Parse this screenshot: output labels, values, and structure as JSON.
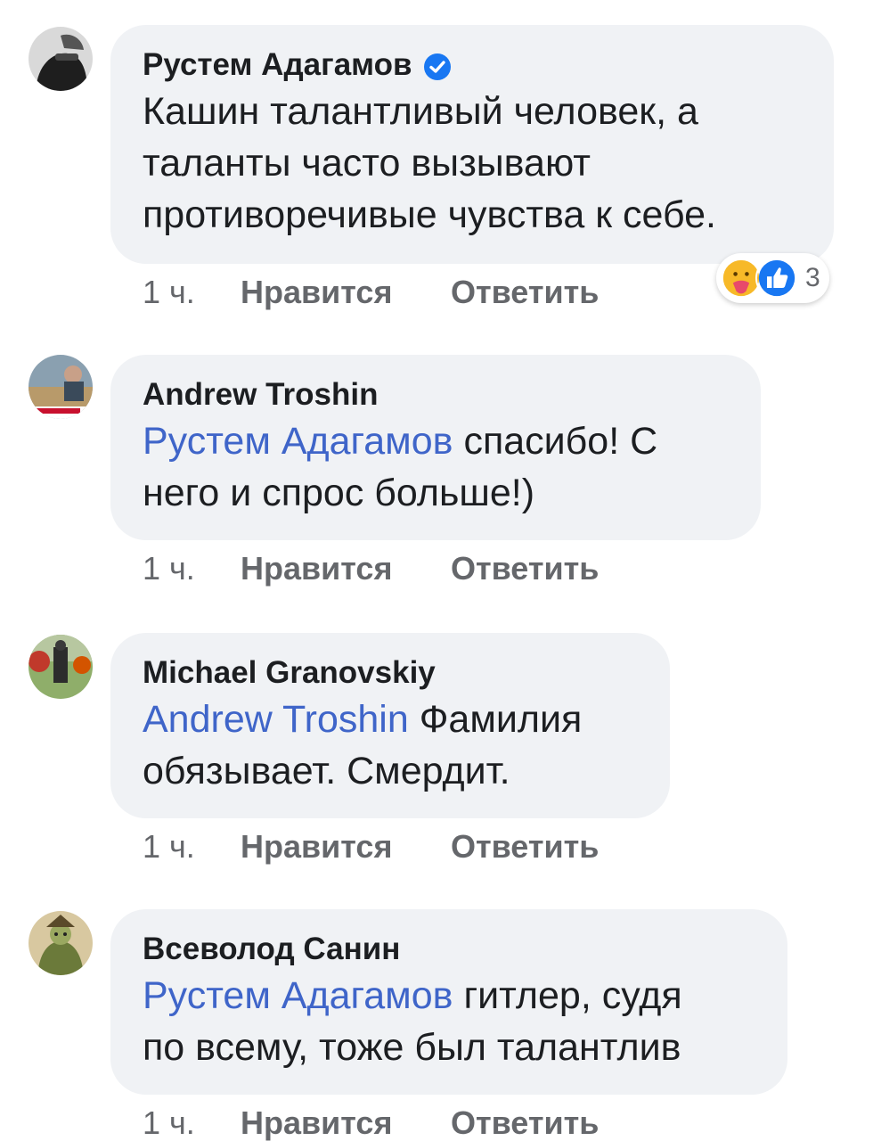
{
  "comments": [
    {
      "author": "Рустем Адагамов",
      "verified": true,
      "mention": "",
      "lines": [
        "Кашин талантливый человек, а",
        "таланты часто вызывают",
        "противоречивые чувства к себе."
      ],
      "time": "1 ч.",
      "like_label": "Нравится",
      "reply_label": "Ответить",
      "reactions": {
        "icons": [
          "care-icon",
          "like-icon"
        ],
        "count": "3"
      }
    },
    {
      "author": "Andrew Troshin",
      "verified": false,
      "mention": "Рустем Адагамов",
      "line1_rest": " спасибо! С",
      "lines": [
        "него и спрос больше!)"
      ],
      "time": "1 ч.",
      "like_label": "Нравится",
      "reply_label": "Ответить"
    },
    {
      "author": "Michael Granovskiy",
      "verified": false,
      "mention": "Andrew Troshin",
      "line1_rest": " Фамилия",
      "lines": [
        "обязывает. Смердит."
      ],
      "time": "1 ч.",
      "like_label": "Нравится",
      "reply_label": "Ответить"
    },
    {
      "author": "Всеволод Санин",
      "verified": false,
      "mention": "Рустем Адагамов",
      "line1_rest": " гитлер, судя",
      "lines": [
        "по всему, тоже был талантлив"
      ],
      "time": "1 ч.",
      "like_label": "Нравится",
      "reply_label": "Ответить"
    }
  ],
  "colors": {
    "bubble": "#f0f2f5",
    "mention": "#3f65c9",
    "meta": "#65676b",
    "verified": "#1877f2"
  }
}
